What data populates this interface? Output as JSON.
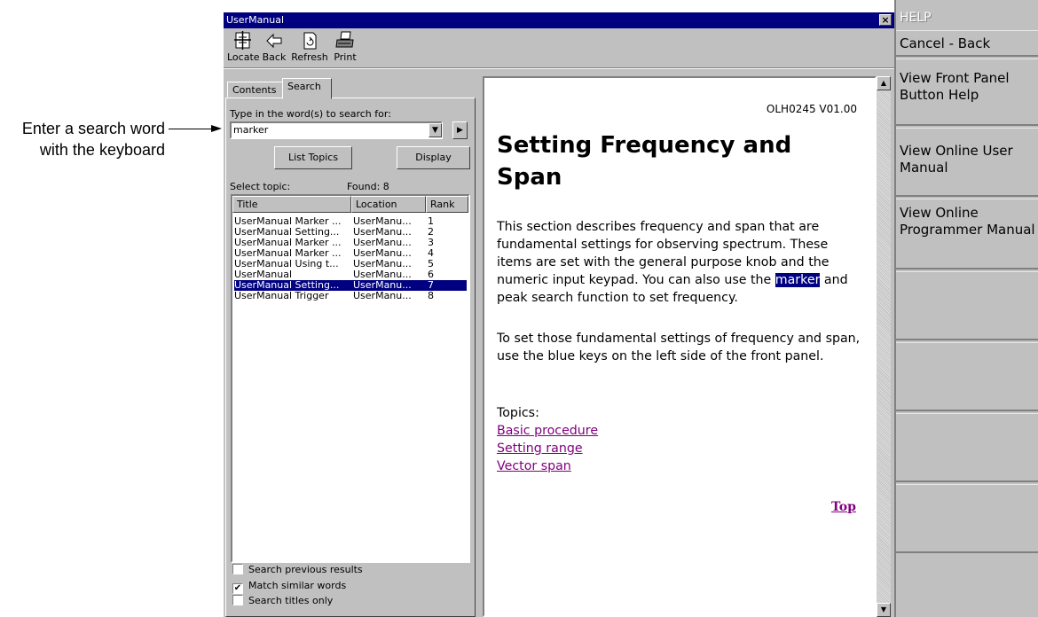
{
  "callout": {
    "text_line1": "Enter a search word",
    "text_line2": "with the keyboard"
  },
  "window": {
    "title": "UserManual",
    "toolbar": [
      {
        "label": "Locate",
        "icon": "locate-icon"
      },
      {
        "label": "Back",
        "icon": "back-arrow-icon"
      },
      {
        "label": "Refresh",
        "icon": "refresh-icon"
      },
      {
        "label": "Print",
        "icon": "printer-icon"
      }
    ]
  },
  "tabs": {
    "contents": "Contents",
    "search": "Search"
  },
  "search": {
    "prompt": "Type in the word(s) to search for:",
    "value": "marker",
    "list_topics": "List Topics",
    "display": "Display",
    "select_topic": "Select topic:",
    "found": "Found: 8",
    "columns": {
      "title": "Title",
      "location": "Location",
      "rank": "Rank"
    },
    "rows": [
      {
        "title": "UserManual Marker ...",
        "location": "UserManu...",
        "rank": "1"
      },
      {
        "title": "UserManual Setting...",
        "location": "UserManu...",
        "rank": "2"
      },
      {
        "title": "UserManual Marker ...",
        "location": "UserManu...",
        "rank": "3"
      },
      {
        "title": "UserManual Marker ...",
        "location": "UserManu...",
        "rank": "4"
      },
      {
        "title": "UserManual Using t...",
        "location": "UserManu...",
        "rank": "5"
      },
      {
        "title": "UserManual",
        "location": "UserManu...",
        "rank": "6"
      },
      {
        "title": "UserManual Setting...",
        "location": "UserManu...",
        "rank": "7"
      },
      {
        "title": "UserManual Trigger",
        "location": "UserManu...",
        "rank": "8"
      }
    ],
    "selected_rank": "7",
    "options": {
      "previous": "Search previous results",
      "similar": "Match similar words",
      "titles": "Search titles only"
    }
  },
  "doc": {
    "id": "OLH0245 V01.00",
    "title_line1": "Setting Frequency and",
    "title_line2": "Span",
    "p1_a": "This section describes frequency and span that are fundamental settings for observing spectrum. These items are set with the general purpose knob and the numeric input keypad. You can also use the",
    "p1_hl": "marker",
    "p1_b": "and peak search function to set frequency.",
    "p2": "To set those fundamental settings of frequency and span, use the blue keys on the left side of the front panel.",
    "topics": "Topics:",
    "links": [
      "Basic procedure",
      "Setting range",
      "Vector span"
    ],
    "top": "Top"
  },
  "side_menu": {
    "title": "HELP",
    "buttons": [
      "Cancel - Back",
      "View Front Panel Button Help",
      "View Online User Manual",
      "View Online Programmer Manual",
      "",
      "",
      "",
      ""
    ]
  },
  "colors": {
    "titlebar": "#000080",
    "chrome": "#c0c0c0",
    "link": "#800080",
    "highlight": "#000080"
  }
}
